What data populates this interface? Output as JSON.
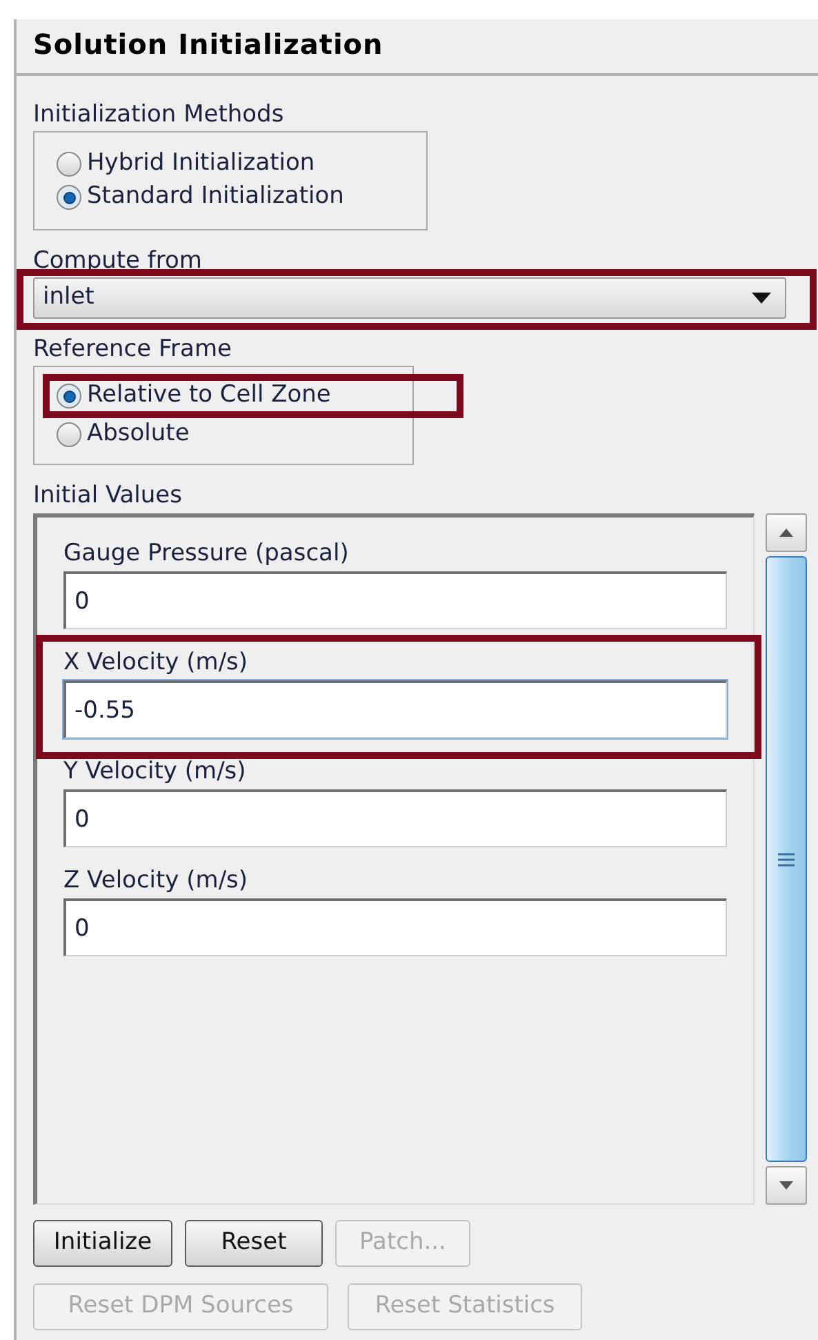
{
  "panel": {
    "title": "Solution Initialization"
  },
  "initialization_methods": {
    "label": "Initialization Methods",
    "options": [
      {
        "label": "Hybrid  Initialization",
        "selected": false,
        "highlighted": false
      },
      {
        "label": "Standard Initialization",
        "selected": true,
        "highlighted": false
      }
    ]
  },
  "compute_from": {
    "label": "Compute from",
    "value": "inlet",
    "highlighted": true
  },
  "reference_frame": {
    "label": "Reference Frame",
    "options": [
      {
        "label": "Relative to Cell Zone",
        "selected": true,
        "highlighted": true
      },
      {
        "label": "Absolute",
        "selected": false,
        "highlighted": false
      }
    ]
  },
  "initial_values": {
    "label": "Initial Values",
    "fields": [
      {
        "label": "Gauge Pressure (pascal)",
        "value": "0",
        "highlighted": false
      },
      {
        "label": "X Velocity (m/s)",
        "value": "-0.55",
        "highlighted": true
      },
      {
        "label": "Y Velocity (m/s)",
        "value": "0",
        "highlighted": false
      },
      {
        "label": "Z Velocity (m/s)",
        "value": "0",
        "highlighted": false
      }
    ]
  },
  "buttons": [
    [
      {
        "label": "Initialize",
        "disabled": false
      },
      {
        "label": "Reset",
        "disabled": false
      },
      {
        "label": "Patch...",
        "disabled": true
      }
    ],
    [
      {
        "label": "Reset DPM Sources",
        "disabled": true
      },
      {
        "label": "Reset Statistics",
        "disabled": true
      }
    ]
  ]
}
